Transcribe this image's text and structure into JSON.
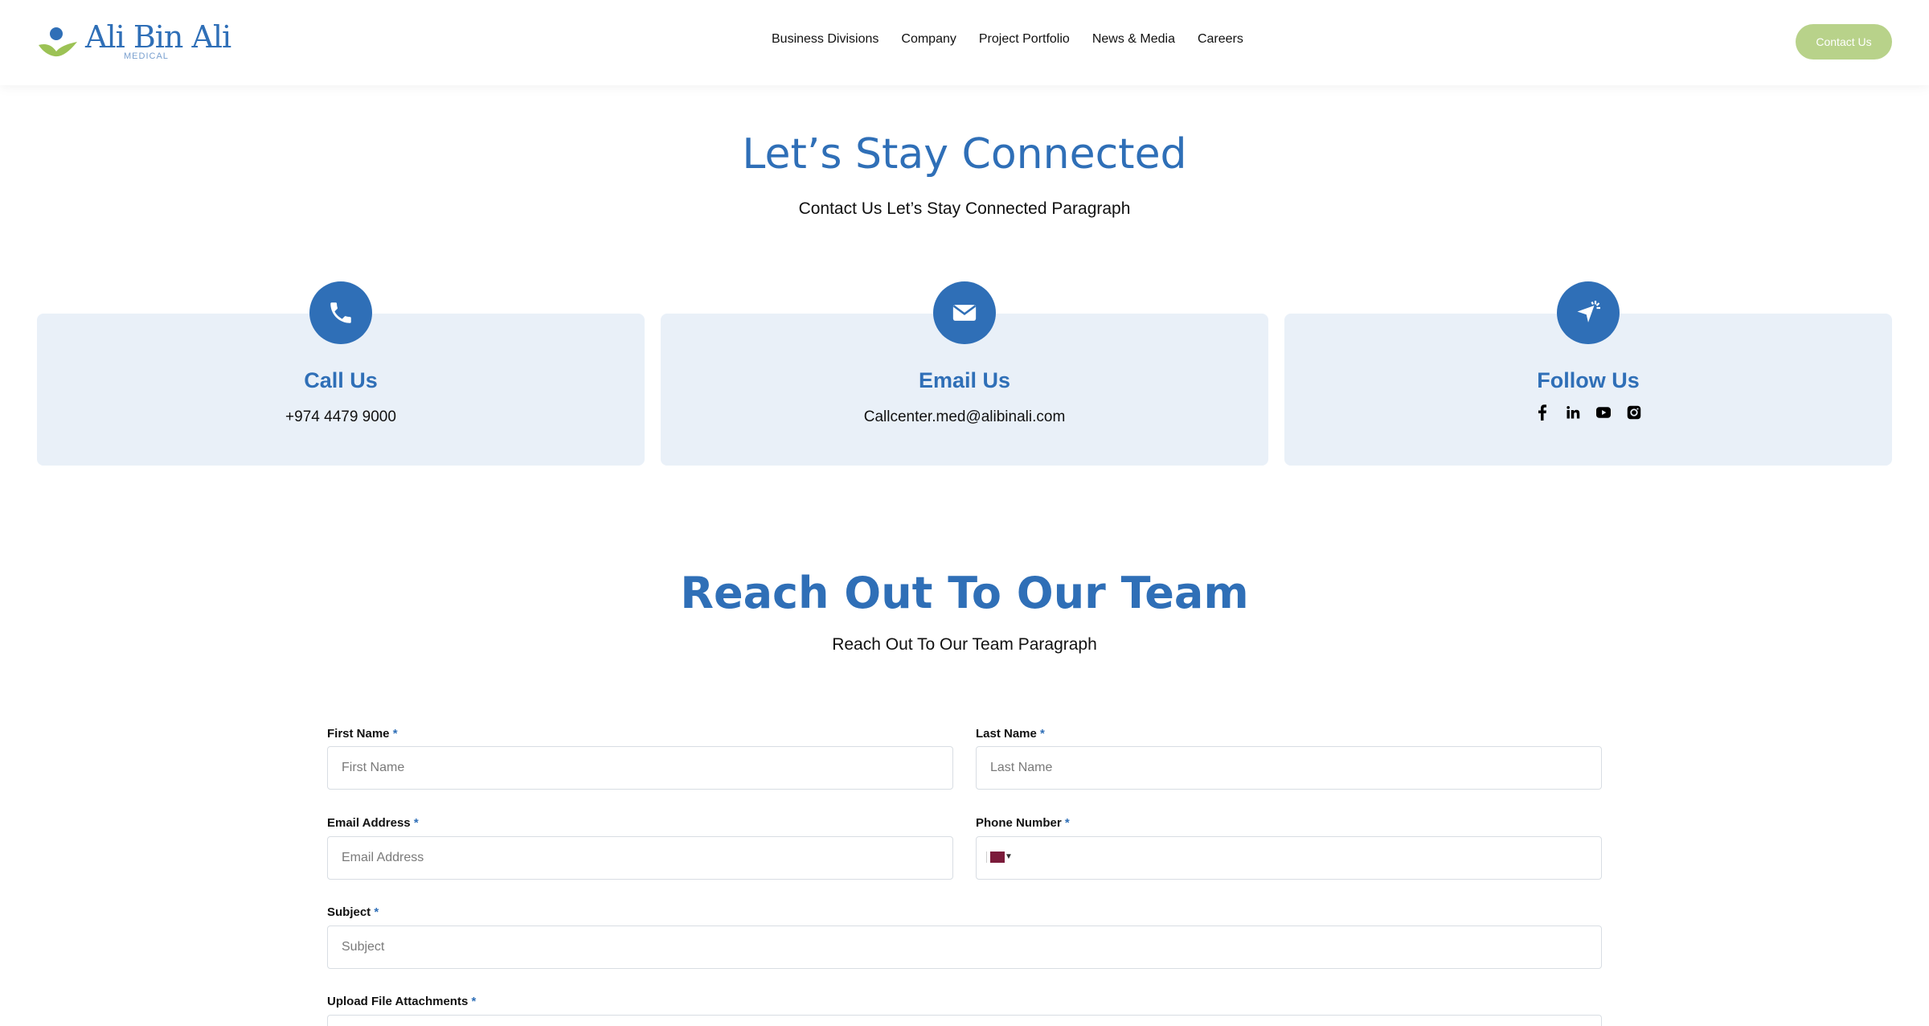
{
  "header": {
    "logo_text": "Ali Bin Ali",
    "logo_sub": "MEDICAL",
    "nav": [
      "Business Divisions",
      "Company",
      "Project Portfolio",
      "News & Media",
      "Careers"
    ],
    "contact_button": "Contact Us"
  },
  "connect": {
    "title": "Let’s Stay Connected",
    "paragraph": "Contact Us Let’s Stay Connected Paragraph",
    "cards": [
      {
        "title": "Call Us",
        "value": "+974 4479 9000",
        "icon": "phone-icon"
      },
      {
        "title": "Email Us",
        "value": "Callcenter.med@alibinali.com",
        "icon": "envelope-icon"
      },
      {
        "title": "Follow Us",
        "icon": "location-arrow-icon",
        "socials": [
          "facebook-icon",
          "linkedin-icon",
          "youtube-icon",
          "instagram-icon"
        ]
      }
    ]
  },
  "reach": {
    "title": "Reach Out To Our Team",
    "paragraph": "Reach Out To Our Team Paragraph"
  },
  "form": {
    "first_name": {
      "label": "First Name",
      "placeholder": "First Name"
    },
    "last_name": {
      "label": "Last Name",
      "placeholder": "Last Name"
    },
    "email": {
      "label": "Email Address",
      "placeholder": "Email Address"
    },
    "phone": {
      "label": "Phone Number"
    },
    "subject": {
      "label": "Subject",
      "placeholder": "Subject"
    },
    "upload": {
      "label": "Upload File Attachments"
    },
    "required_mark": "*"
  },
  "colors": {
    "primary": "#2f6fb7",
    "accent": "#b8d28a",
    "card_bg": "#e9f0f8"
  }
}
